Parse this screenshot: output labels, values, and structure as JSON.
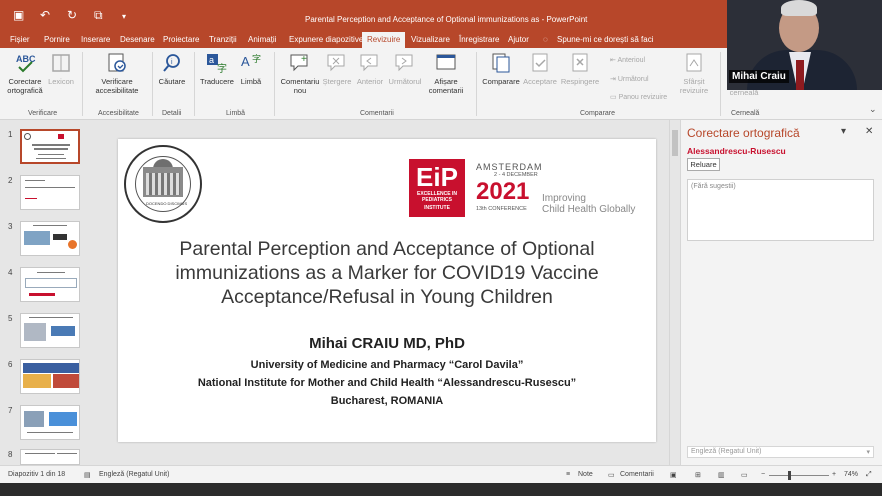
{
  "window": {
    "title": "Parental Perception and Acceptance of Optional immunizations as  -  PowerPoint"
  },
  "menu": {
    "tabs": [
      "Fișier",
      "Pornire",
      "Inserare",
      "Desenare",
      "Proiectare",
      "Tranziții",
      "Animații",
      "Expunere diapozitive",
      "Revizuire",
      "Vizualizare",
      "Înregistrare",
      "Ajutor"
    ],
    "active": "Revizuire",
    "tell_me": "Spune-mi ce dorești să faci"
  },
  "ribbon": {
    "spelling": "Corectare ortografică",
    "thesaurus": "Lexicon",
    "check_access": "Verificare accesibilitate",
    "smart_lookup": "Căutare",
    "translate": "Traducere",
    "language": "Limbă",
    "new_comment": "Comentariu nou",
    "delete": "Ștergere",
    "previous": "Anterior",
    "next": "Următorul",
    "show_comments": "Afișare comentarii",
    "compare": "Comparare",
    "accept": "Acceptare",
    "reject": "Respingere",
    "prev_small": "Anterioul",
    "next_small": "Următorul",
    "reviewing_pane": "Panou revizuire",
    "end_review": "Sfârșit revizuire",
    "ink": "cerneală",
    "groups": {
      "proofing": "Verificare",
      "accessibility": "Accesibilitate",
      "insights": "Detalii",
      "language": "Limbă",
      "comments": "Comentarii",
      "compare": "Comparare",
      "ink": "Cerneală"
    }
  },
  "webcam": {
    "name": "Mihai Craiu"
  },
  "thumbnails": [
    "1",
    "2",
    "3",
    "4",
    "5",
    "6",
    "7",
    "8"
  ],
  "slide": {
    "seal_motto": "DOCENDO DISCIMUS",
    "eip": {
      "logo": "EiP",
      "logo_sub": "EXCELLENCE IN PEDIATRICS",
      "logo_inst": "INSTITUTE",
      "city": "AMSTERDAM",
      "dates": "2 - 4 DECEMBER",
      "year": "2021",
      "conference": "13th CONFERENCE",
      "tagline1": "Improving",
      "tagline2": "Child Health Globally"
    },
    "title": "Parental Perception and Acceptance of Optional immunizations as a Marker for COVID19 Vaccine Acceptance/Refusal in Young Children",
    "author": "Mihai CRAIU MD, PhD",
    "affil1": "University of Medicine and Pharmacy “Carol Davila”",
    "affil2": "National Institute for Mother and Child Health “Alessandrescu-Rusescu”",
    "affil3": "Bucharest, ROMANIA"
  },
  "pane": {
    "title": "Corectare ortografică",
    "misspelled": "Alessandrescu-Rusescu",
    "resume": "Reluare",
    "no_suggestions": "(Fără sugestii)",
    "language": "Engleză (Regatul Unit)"
  },
  "status": {
    "slide_of": "Diapozitiv 1 din 18",
    "language": "Engleză (Regatul Unit)",
    "notes": "Note",
    "comments": "Comentarii",
    "zoom": "74%"
  }
}
